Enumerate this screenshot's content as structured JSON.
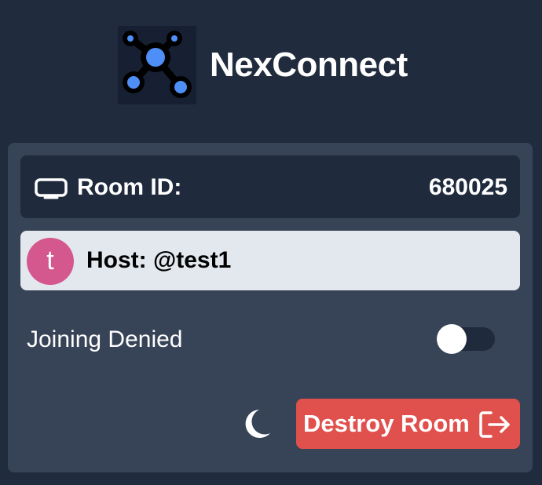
{
  "app": {
    "name": "NexConnect",
    "logo_icon": "network-nodes-logo"
  },
  "room": {
    "label": "Room ID:",
    "id": "680025",
    "icon": "tv-icon"
  },
  "host": {
    "avatar_letter": "t",
    "avatar_color": "#d4588e",
    "label": "Host: @test1"
  },
  "settings": {
    "joining_label": "Joining Denied",
    "joining_allowed": false,
    "theme_icon": "moon-icon"
  },
  "actions": {
    "destroy_label": "Destroy Room",
    "destroy_icon": "logout-icon",
    "destroy_color": "#e0504c"
  },
  "colors": {
    "background": "#202b3d",
    "panel": "#374357",
    "logo_accent": "#4d8ef7"
  }
}
